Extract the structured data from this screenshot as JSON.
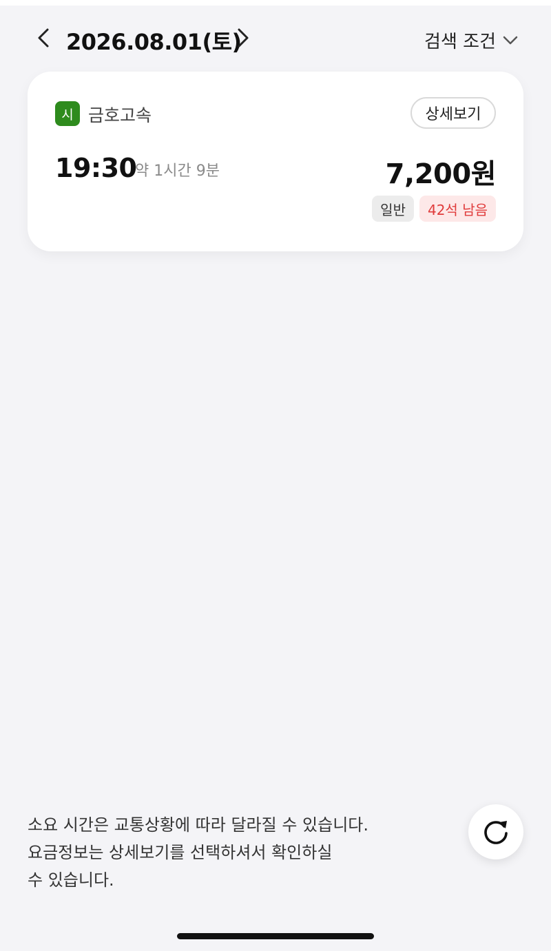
{
  "header": {
    "date_title": "2026.08.01(토)",
    "prev_icon": "chevron-left-icon",
    "next_icon": "chevron-right-icon",
    "search_filter_label": "검색 조건",
    "search_filter_icon": "chevron-down-icon"
  },
  "results": [
    {
      "company_badge": "시",
      "company_badge_color": "#2e8b1d",
      "company_name": "금호고속",
      "detail_button_label": "상세보기",
      "depart_time": "19:30",
      "duration": "약 1시간 9분",
      "price": "7,200원",
      "grade_tag": "일반",
      "seats_tag": "42석 남음"
    }
  ],
  "footer": {
    "notice_line1": "소요 시간은 교통상황에 따라 달라질 수 있습니다.",
    "notice_line2": "요금정보는 상세보기를 선택하셔서 확인하실",
    "notice_line3": "수 있습니다.",
    "refresh_icon": "refresh-icon"
  },
  "colors": {
    "background": "#f4f4f7",
    "seats_text": "#e03b3b",
    "seats_bg": "#fde8e8"
  }
}
